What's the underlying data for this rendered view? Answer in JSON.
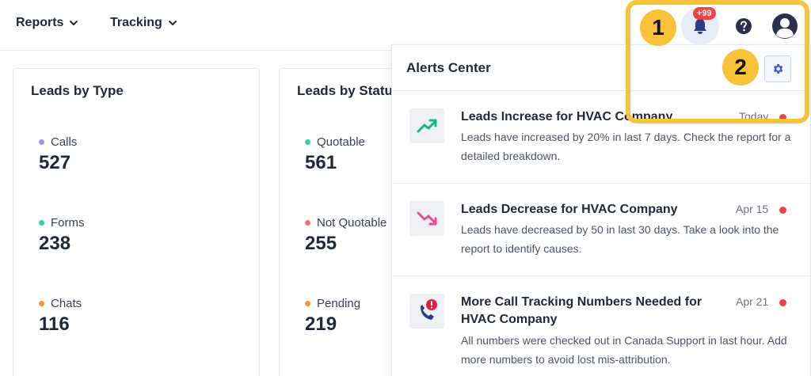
{
  "nav": {
    "reports_label": "Reports",
    "tracking_label": "Tracking"
  },
  "header": {
    "notification_badge": "+99"
  },
  "cards": [
    {
      "title": "Leads by Type",
      "stats": [
        {
          "label": "Calls",
          "value": "527",
          "dot_color": "#a78bfa"
        },
        {
          "label": "Forms",
          "value": "238",
          "dot_color": "#34d399"
        },
        {
          "label": "Chats",
          "value": "116",
          "dot_color": "#fb923c"
        }
      ]
    },
    {
      "title": "Leads by Status",
      "stats": [
        {
          "label": "Quotable",
          "value": "561",
          "dot_color": "#34d399"
        },
        {
          "label": "Not Quotable",
          "value": "255",
          "dot_color": "#f87171"
        },
        {
          "label": "Pending",
          "value": "219",
          "dot_color": "#fb923c"
        }
      ]
    }
  ],
  "alerts": {
    "title": "Alerts Center",
    "items": [
      {
        "title": "Leads Increase for HVAC Company",
        "body": "Leads have increased by 20% in last 7 days. Check the report for a detailed breakdown.",
        "date": "Today",
        "icon": "trending-up-icon"
      },
      {
        "title": "Leads Decrease for HVAC Company",
        "body": "Leads have decreased by 50 in last 30 days. Take a look into the report to identify causes.",
        "date": "Apr 15",
        "icon": "trending-down-icon"
      },
      {
        "title": "More Call Tracking Numbers Needed for HVAC Company",
        "body": "All numbers were checked out in Canada Support in last hour. Add more numbers to avoid lost mis-attribution.",
        "date": "Apr 21",
        "icon": "phone-alert-icon"
      }
    ]
  },
  "callouts": [
    "1",
    "2"
  ],
  "colors": {
    "callout": "#f8c33a",
    "unread_dot": "#ef4444",
    "accent": "#3b5bdb"
  }
}
